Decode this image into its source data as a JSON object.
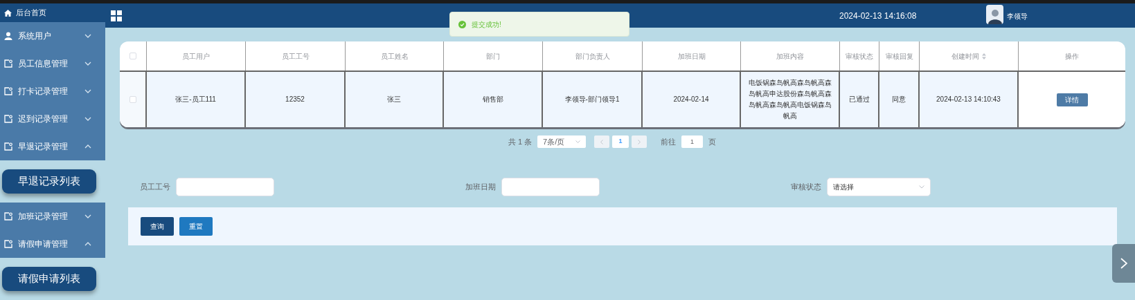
{
  "sidebar": {
    "home": "后台首页",
    "items": [
      {
        "label": "系统用户",
        "kind": "user",
        "expanded": false
      },
      {
        "label": "员工信息管理",
        "kind": "doc",
        "expanded": false
      },
      {
        "label": "打卡记录管理",
        "kind": "doc",
        "expanded": false
      },
      {
        "label": "迟到记录管理",
        "kind": "doc",
        "expanded": false
      },
      {
        "label": "早退记录管理",
        "kind": "doc",
        "expanded": true,
        "children": [
          {
            "label": "早退记录列表"
          }
        ]
      },
      {
        "label": "加班记录管理",
        "kind": "doc",
        "expanded": false
      },
      {
        "label": "请假申请管理",
        "kind": "doc",
        "expanded": true,
        "children": [
          {
            "label": "请假申请列表"
          }
        ]
      }
    ]
  },
  "header": {
    "datetime": "2024-02-13 14:16:08",
    "user": "李领导"
  },
  "toast": {
    "message": "提交成功!"
  },
  "table": {
    "select_all": {
      "checked": false
    },
    "columns": [
      {
        "label": "员工用户"
      },
      {
        "label": "员工工号"
      },
      {
        "label": "员工姓名"
      },
      {
        "label": "部门"
      },
      {
        "label": "部门负责人"
      },
      {
        "label": "加班日期"
      },
      {
        "label": "加班内容"
      },
      {
        "label": "审核状态"
      },
      {
        "label": "审核回复"
      },
      {
        "label": "创建时间",
        "sortable": true
      },
      {
        "label": "操作"
      }
    ],
    "rows": [
      {
        "checked": false,
        "cells": [
          "张三-员工111",
          "12352",
          "张三",
          "销售部",
          "李领导-部门领导1",
          "2024-02-14",
          "电饭锅森岛帆高森岛帆高森岛帆高申达股份森岛帆高森岛帆高森岛帆高电饭锅森岛帆高",
          "已通过",
          "同意",
          "2024-02-13 14:10:43"
        ],
        "action": "详情"
      }
    ]
  },
  "pagination": {
    "total": "共 1 条",
    "page_size": "7条/页",
    "pages": [
      {
        "label": "1",
        "selected": true
      }
    ],
    "goto_label": "前往",
    "goto_value": "1",
    "goto_suffix": "页"
  },
  "search": {
    "fields": [
      {
        "label": "员工工号",
        "kind": "text"
      },
      {
        "label": "加班日期",
        "kind": "text"
      },
      {
        "label": "审核状态",
        "kind": "select",
        "placeholder": "请选择"
      }
    ],
    "buttons": [
      {
        "label": "查询",
        "kind": "primary"
      },
      {
        "label": "重置",
        "kind": "secondary"
      }
    ]
  }
}
